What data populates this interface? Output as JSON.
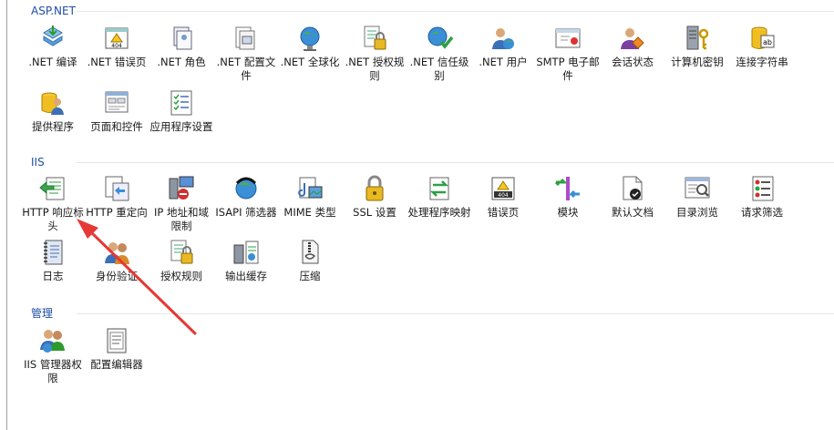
{
  "sections": [
    {
      "title": "ASP.NET",
      "items": [
        {
          "label": ".NET 编译",
          "icon": "net-compile-icon"
        },
        {
          "label": ".NET 错误页",
          "icon": "net-error-page-icon"
        },
        {
          "label": ".NET 角色",
          "icon": "net-roles-icon"
        },
        {
          "label": ".NET 配置文件",
          "icon": "net-profile-icon"
        },
        {
          "label": ".NET 全球化",
          "icon": "net-globalization-icon"
        },
        {
          "label": ".NET 授权规则",
          "icon": "net-authorization-icon"
        },
        {
          "label": ".NET 信任级别",
          "icon": "net-trust-levels-icon"
        },
        {
          "label": ".NET 用户",
          "icon": "net-users-icon"
        },
        {
          "label": "SMTP 电子邮件",
          "icon": "smtp-email-icon"
        },
        {
          "label": "会话状态",
          "icon": "session-state-icon"
        },
        {
          "label": "计算机密钥",
          "icon": "machine-key-icon"
        },
        {
          "label": "连接字符串",
          "icon": "connection-strings-icon"
        },
        {
          "label": "提供程序",
          "icon": "providers-icon"
        },
        {
          "label": "页面和控件",
          "icon": "pages-controls-icon"
        },
        {
          "label": "应用程序设置",
          "icon": "app-settings-icon"
        }
      ]
    },
    {
      "title": "IIS",
      "items": [
        {
          "label": "HTTP 响应标头",
          "icon": "http-response-headers-icon"
        },
        {
          "label": "HTTP 重定向",
          "icon": "http-redirect-icon"
        },
        {
          "label": "IP 地址和域限制",
          "icon": "ip-domain-restrictions-icon"
        },
        {
          "label": "ISAPI 筛选器",
          "icon": "isapi-filters-icon"
        },
        {
          "label": "MIME 类型",
          "icon": "mime-types-icon"
        },
        {
          "label": "SSL 设置",
          "icon": "ssl-settings-icon"
        },
        {
          "label": "处理程序映射",
          "icon": "handler-mappings-icon"
        },
        {
          "label": "错误页",
          "icon": "error-pages-icon"
        },
        {
          "label": "模块",
          "icon": "modules-icon"
        },
        {
          "label": "默认文档",
          "icon": "default-document-icon"
        },
        {
          "label": "目录浏览",
          "icon": "directory-browsing-icon"
        },
        {
          "label": "请求筛选",
          "icon": "request-filtering-icon"
        },
        {
          "label": "日志",
          "icon": "logging-icon"
        },
        {
          "label": "身份验证",
          "icon": "authentication-icon"
        },
        {
          "label": "授权规则",
          "icon": "authorization-rules-icon"
        },
        {
          "label": "输出缓存",
          "icon": "output-caching-icon"
        },
        {
          "label": "压缩",
          "icon": "compression-icon"
        }
      ]
    },
    {
      "title": "管理",
      "items": [
        {
          "label": "IIS 管理器权限",
          "icon": "iis-manager-permissions-icon"
        },
        {
          "label": "配置编辑器",
          "icon": "configuration-editor-icon"
        }
      ]
    }
  ],
  "colors": {
    "section_title": "#1f4ea5",
    "annotation_arrow": "#e53935"
  }
}
